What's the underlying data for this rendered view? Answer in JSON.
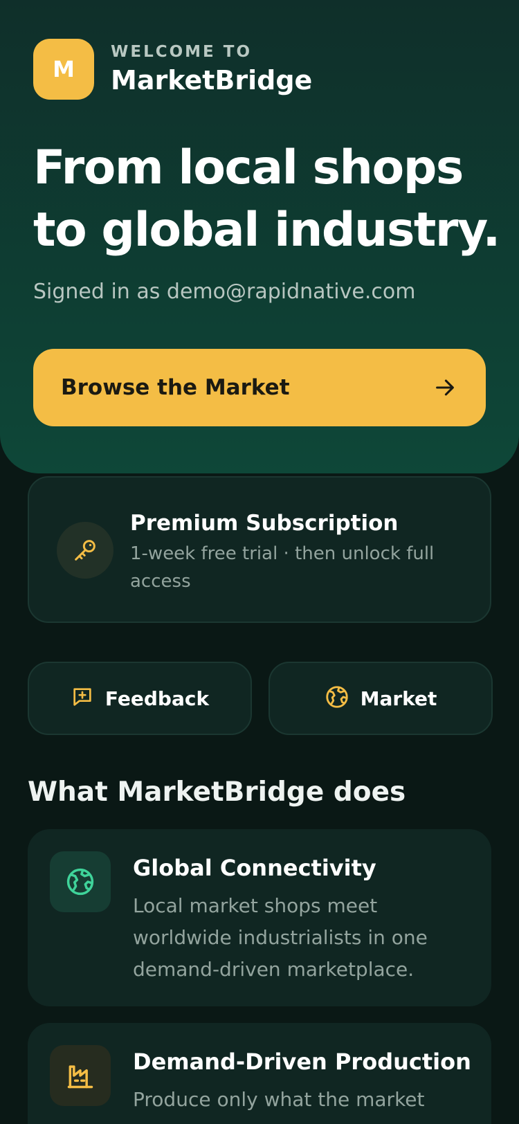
{
  "brand": {
    "logo_letter": "M",
    "welcome": "WELCOME TO",
    "name": "MarketBridge"
  },
  "hero": {
    "headline_line1": "From local shops",
    "headline_line2": "to global industry.",
    "signed_in": "Signed in as demo@rapidnative.com",
    "cta_label": "Browse the Market"
  },
  "premium": {
    "title": "Premium Subscription",
    "subtitle": "1-week free trial · then unlock full access",
    "icon": "key-icon"
  },
  "quick_actions": [
    {
      "label": "Feedback",
      "icon": "message-plus-icon"
    },
    {
      "label": "Market",
      "icon": "globe-icon"
    }
  ],
  "section": {
    "title": "What MarketBridge does"
  },
  "features": [
    {
      "title": "Global Connectivity",
      "description": "Local market shops meet worldwide industrialists in one demand-driven marketplace.",
      "icon": "globe-icon"
    },
    {
      "title": "Demand-Driven Production",
      "description": "Produce only what the market",
      "icon": "factory-icon"
    }
  ],
  "colors": {
    "accent": "#f4bd45",
    "hero_top": "#0f2f2a",
    "hero_bottom": "#0e4738",
    "background": "#0a1815",
    "card": "#102622",
    "green_icon": "#3fd39a"
  }
}
